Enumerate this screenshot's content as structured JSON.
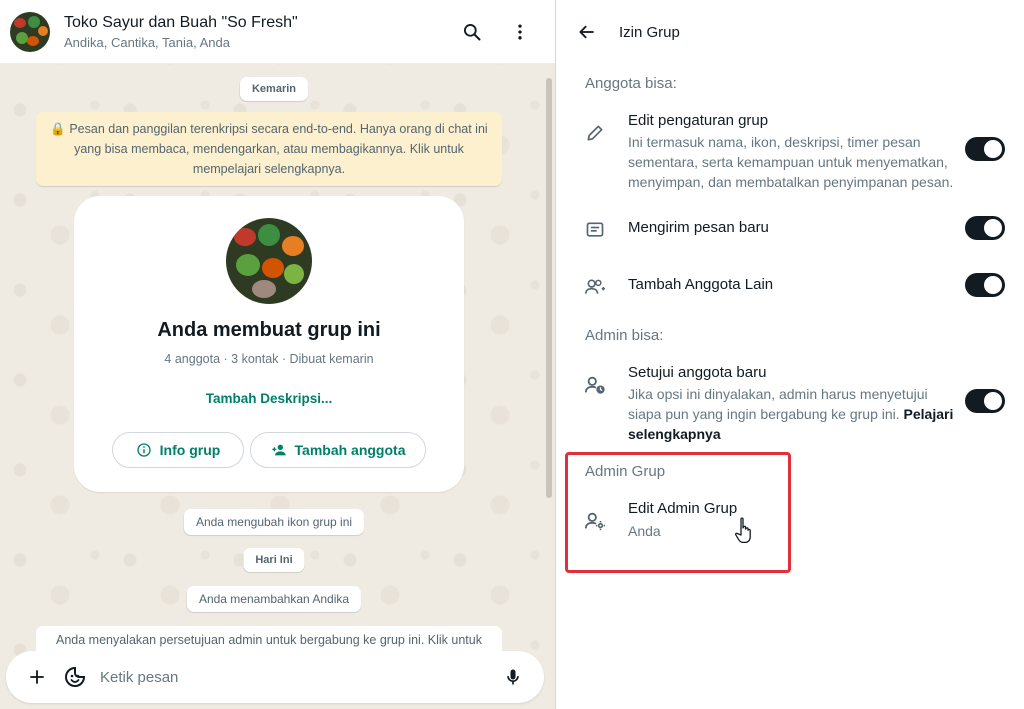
{
  "chat": {
    "title": "Toko Sayur dan Buah \"So Fresh\"",
    "members": "Andika, Cantika, Tania, Anda",
    "date_yesterday": "Kemarin",
    "encryption_notice": "🔒 Pesan dan panggilan terenkripsi secara end-to-end. Hanya orang di chat ini yang bisa membaca, mendengarkan, atau membagikannya. Klik untuk mempelajari selengkapnya.",
    "card": {
      "title": "Anda membuat grup ini",
      "meta": "4 anggota · 3 kontak · Dibuat kemarin",
      "add_description": "Tambah Deskripsi...",
      "info_button": "Info grup",
      "add_member_button": "Tambah anggota"
    },
    "system_changed_icon": "Anda mengubah ikon grup ini",
    "date_today": "Hari Ini",
    "system_added": "Anda menambahkan Andika",
    "system_approval": "Anda menyalakan persetujuan admin untuk bergabung ke grup ini. Klik untuk",
    "composer_placeholder": "Ketik pesan"
  },
  "panel": {
    "title": "Izin Grup",
    "members_can": "Anggota bisa:",
    "edit_settings": {
      "title": "Edit pengaturan grup",
      "desc": "Ini termasuk nama, ikon, deskripsi, timer pesan sementara, serta kemampuan untuk menyematkan, menyimpan, dan membatalkan penyimpanan pesan.",
      "enabled": true
    },
    "send_messages": {
      "title": "Mengirim pesan baru",
      "enabled": true
    },
    "add_members": {
      "title": "Tambah Anggota Lain",
      "enabled": true
    },
    "admins_can": "Admin bisa:",
    "approve_members": {
      "title": "Setujui anggota baru",
      "desc": "Jika opsi ini dinyalakan, admin harus menyetujui siapa pun yang ingin bergabung ke grup ini.",
      "learn_more": "Pelajari selengkapnya",
      "enabled": true
    },
    "admin_group_section": "Admin Grup",
    "edit_admins": {
      "title": "Edit Admin Grup",
      "subtitle": "Anda"
    }
  },
  "colors": {
    "accent": "#008069",
    "toggle_on": "#111b21",
    "highlight": "#e0303b",
    "encryption_bg": "#fdf0cf"
  }
}
